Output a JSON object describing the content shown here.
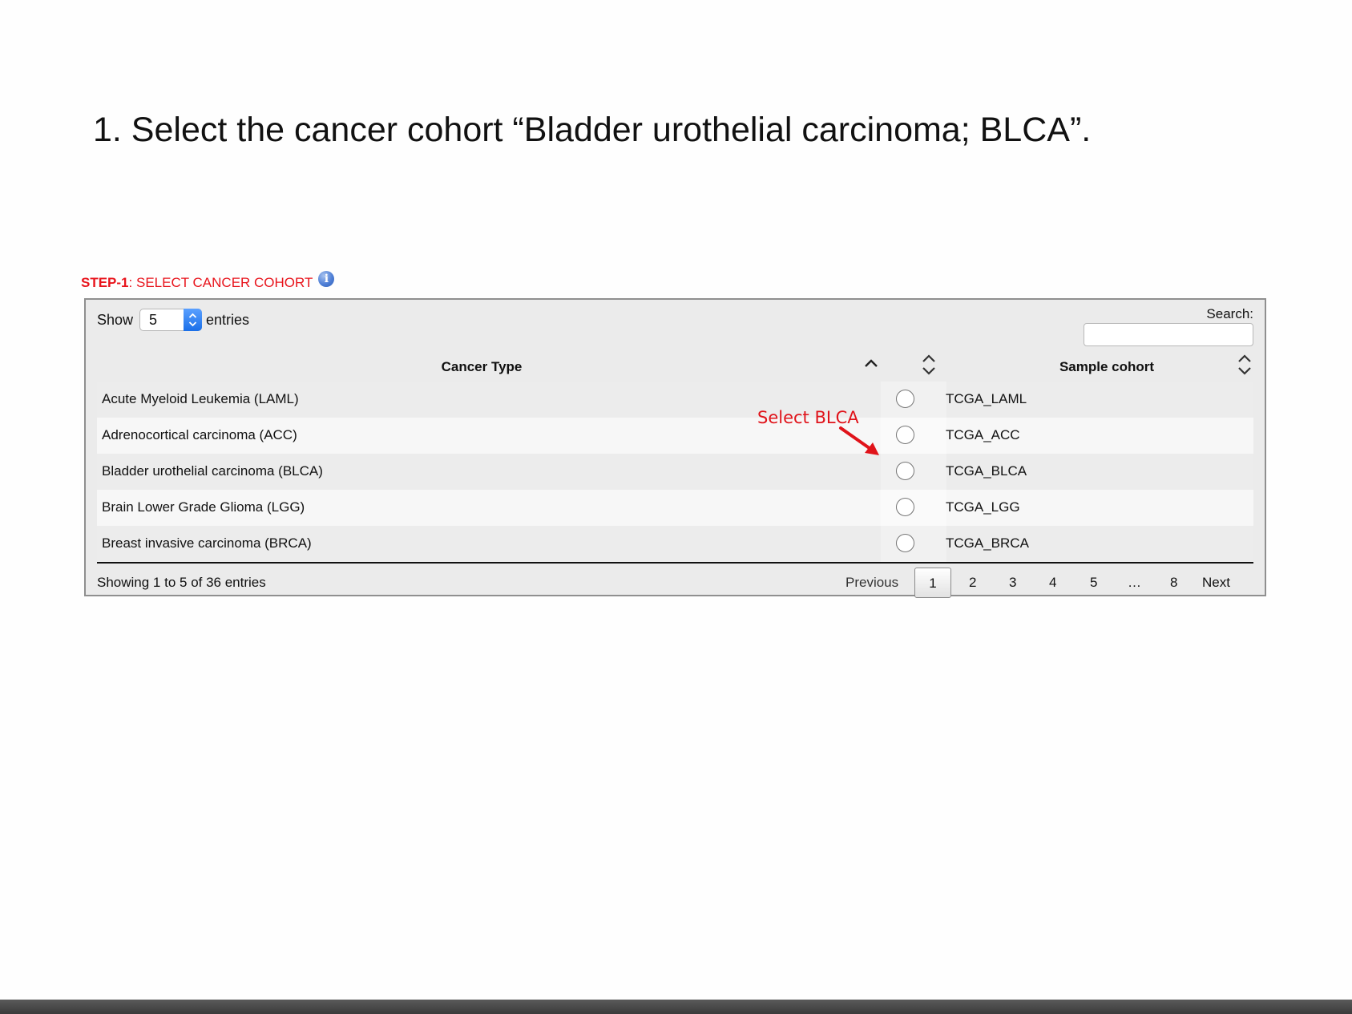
{
  "slide": {
    "title": "1. Select the cancer cohort “Bladder urothelial carcinoma; BLCA”."
  },
  "step": {
    "label_bold": "STEP-1",
    "label_rest": " : SELECT CANCER COHORT",
    "info_icon": "info-icon",
    "info_glyph": "i"
  },
  "table_controls": {
    "show_label": "Show",
    "page_length": "5",
    "entries_label": "entries",
    "search_label": "Search:",
    "search_value": ""
  },
  "columns": {
    "cancer_type": "Cancer Type",
    "sample_cohort": "Sample cohort"
  },
  "rows": [
    {
      "cancer_type": "Acute Myeloid Leukemia (LAML)",
      "sample_cohort": "TCGA_LAML"
    },
    {
      "cancer_type": "Adrenocortical carcinoma (ACC)",
      "sample_cohort": "TCGA_ACC"
    },
    {
      "cancer_type": "Bladder urothelial carcinoma (BLCA)",
      "sample_cohort": "TCGA_BLCA"
    },
    {
      "cancer_type": "Brain Lower Grade Glioma (LGG)",
      "sample_cohort": "TCGA_LGG"
    },
    {
      "cancer_type": "Breast invasive carcinoma (BRCA)",
      "sample_cohort": "TCGA_BRCA"
    }
  ],
  "footer": {
    "showing_info": "Showing 1 to 5 of 36 entries"
  },
  "pagination": {
    "previous": "Previous",
    "pages": [
      "1",
      "2",
      "3",
      "4",
      "5",
      "…",
      "8"
    ],
    "current_page": "1",
    "next": "Next"
  },
  "annotation": {
    "label": "Select BLCA",
    "color": "#e0131a"
  },
  "colors": {
    "accent_red": "#e8141c",
    "select_blue": "#1a6fe8",
    "panel_bg": "#ebebeb"
  }
}
